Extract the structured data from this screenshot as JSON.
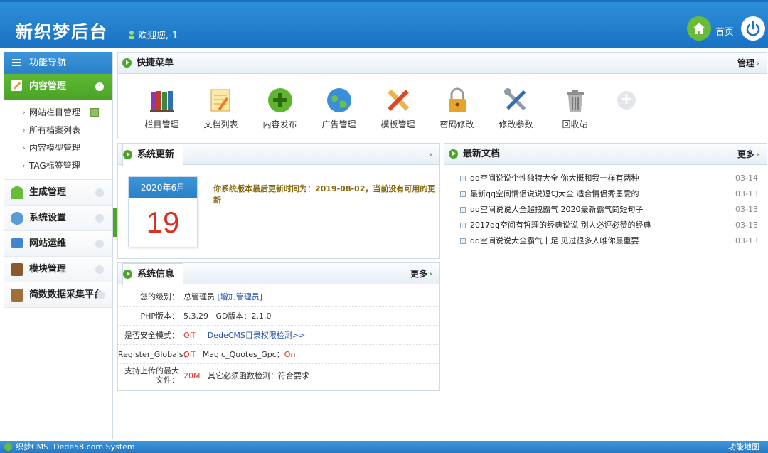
{
  "header": {
    "logo": "新织梦后台",
    "welcome": "欢迎您,-1",
    "home_label": "首页"
  },
  "sidebar": {
    "title": "功能导航",
    "active": "内容管理",
    "sub_items": [
      "网站栏目管理",
      "所有档案列表",
      "内容模型管理",
      "TAG标签管理"
    ],
    "items": [
      "生成管理",
      "系统设置",
      "网站运维",
      "模块管理",
      "简数数据采集平台"
    ]
  },
  "quick_menu": {
    "title": "快捷菜单",
    "manage": "管理",
    "items": [
      {
        "label": "栏目管理",
        "icon": "books-icon"
      },
      {
        "label": "文档列表",
        "icon": "notepad-icon"
      },
      {
        "label": "内容发布",
        "icon": "plus-circle-icon"
      },
      {
        "label": "广告管理",
        "icon": "globe-icon"
      },
      {
        "label": "模板管理",
        "icon": "ruler-pencil-icon"
      },
      {
        "label": "密码修改",
        "icon": "lock-icon"
      },
      {
        "label": "修改参数",
        "icon": "tools-icon"
      },
      {
        "label": "回收站",
        "icon": "trash-icon"
      }
    ]
  },
  "update": {
    "title": "系统更新",
    "cal_month": "2020年6月",
    "cal_day": "19",
    "message": "你系统版本最后更新时间为：2019-08-02，当前没有可用的更新"
  },
  "sysinfo": {
    "title": "系统信息",
    "more": "更多",
    "level_k": "您的级别：",
    "level_v": "总管理员",
    "level_link": "[增加管理员]",
    "php_k": "PHP版本：",
    "php_v": "5.3.29",
    "gd_k": "GD版本：",
    "gd_v": "2.1.0",
    "safe_k": "是否安全模式：",
    "safe_v": "Off",
    "safe_link": "DedeCMS目录权限检测>>",
    "rg_k": "Register_Globals：",
    "rg_v": "Off",
    "mq_k": "Magic_Quotes_Gpc：",
    "mq_v": "On",
    "upload_k": "支持上传的最大文件：",
    "upload_v": "20M",
    "func_k": "其它必须函数检测：",
    "func_v": "符合要求"
  },
  "latest": {
    "title": "最新文档",
    "more": "更多",
    "items": [
      {
        "title": "qq空间说说个性独特大全 你大概和我一样有两种",
        "date": "03-14"
      },
      {
        "title": "最新qq空间情侣说说短句大全 适合情侣秀恩爱的",
        "date": "03-13"
      },
      {
        "title": "qq空间说说大全超拽霸气 2020最新霸气简短句子",
        "date": "03-13"
      },
      {
        "title": "2017qq空间有哲理的经典说说 别人必评必赞的经典",
        "date": "03-13"
      },
      {
        "title": "qq空间说说大全霸气十足 见过很多人唯你最重要",
        "date": "03-13"
      }
    ]
  },
  "footer": {
    "brand": "织梦CMS  Dede58.com System",
    "map": "功能地图"
  },
  "colors": {
    "header_blue": "#1f7ac8",
    "active_green": "#4ca428",
    "date_red": "#d83224"
  }
}
